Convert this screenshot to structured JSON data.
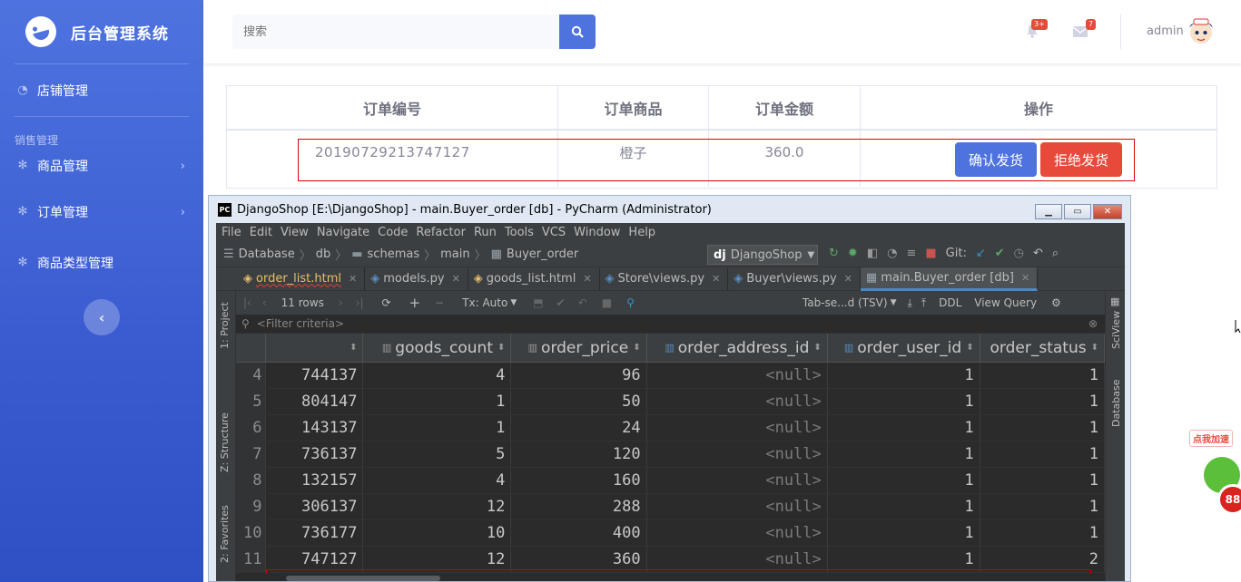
{
  "sidebar": {
    "brand": "后台管理系统",
    "items": [
      {
        "label": "店铺管理"
      },
      {
        "label": "商品管理"
      },
      {
        "label": "订单管理"
      },
      {
        "label": "商品类型管理"
      }
    ],
    "heading": "销售管理"
  },
  "topbar": {
    "search_placeholder": "搜索",
    "bell_badge": "3+",
    "mail_badge": "7",
    "user": "admin"
  },
  "order_table": {
    "headers": [
      "订单编号",
      "订单商品",
      "订单金额",
      "操作"
    ],
    "row": {
      "id": "20190729213747127",
      "goods": "橙子",
      "amount": "360.0"
    },
    "confirm_label": "确认发货",
    "reject_label": "拒绝发货"
  },
  "pycharm": {
    "title": "DjangoShop [E:\\DjangoShop] - main.Buyer_order [db] - PyCharm (Administrator)",
    "menu": [
      "File",
      "Edit",
      "View",
      "Navigate",
      "Code",
      "Refactor",
      "Run",
      "Tools",
      "VCS",
      "Window",
      "Help"
    ],
    "breadcrumbs": [
      "Database",
      "db",
      "schemas",
      "main",
      "Buyer_order"
    ],
    "run_config": "DjangoShop",
    "git_label": "Git:",
    "tabs": [
      {
        "label": "order_list.html",
        "type": "html"
      },
      {
        "label": "models.py",
        "type": "py"
      },
      {
        "label": "goods_list.html",
        "type": "html"
      },
      {
        "label": "Store\\views.py",
        "type": "py"
      },
      {
        "label": "Buyer\\views.py",
        "type": "py"
      },
      {
        "label": "main.Buyer_order [db]",
        "type": "db",
        "active": true
      }
    ],
    "rows_count": "11 rows",
    "tx_mode": "Tx: Auto",
    "export_format": "Tab-se...d (TSV)",
    "ddl_label": "DDL",
    "view_query_label": "View Query",
    "filter_placeholder": "<Filter criteria>",
    "left_strip": [
      "1: Project",
      "Z: Structure",
      "2: Favorites"
    ],
    "right_strip": [
      "SciView",
      "Database"
    ],
    "columns": [
      "goods_count",
      "order_price",
      "order_address_id",
      "order_user_id",
      "order_status"
    ],
    "rows": [
      {
        "n": "4",
        "c0": "744137",
        "goods_count": "4",
        "order_price": "96",
        "addr": "<null>",
        "user": "1",
        "status": "1"
      },
      {
        "n": "5",
        "c0": "804147",
        "goods_count": "1",
        "order_price": "50",
        "addr": "<null>",
        "user": "1",
        "status": "1"
      },
      {
        "n": "6",
        "c0": "143137",
        "goods_count": "1",
        "order_price": "24",
        "addr": "<null>",
        "user": "1",
        "status": "1"
      },
      {
        "n": "7",
        "c0": "736137",
        "goods_count": "5",
        "order_price": "120",
        "addr": "<null>",
        "user": "1",
        "status": "1"
      },
      {
        "n": "8",
        "c0": "132157",
        "goods_count": "4",
        "order_price": "160",
        "addr": "<null>",
        "user": "1",
        "status": "1"
      },
      {
        "n": "9",
        "c0": "306137",
        "goods_count": "12",
        "order_price": "288",
        "addr": "<null>",
        "user": "1",
        "status": "1"
      },
      {
        "n": "10",
        "c0": "736177",
        "goods_count": "10",
        "order_price": "400",
        "addr": "<null>",
        "user": "1",
        "status": "1"
      },
      {
        "n": "11",
        "c0": "747127",
        "goods_count": "12",
        "order_price": "360",
        "addr": "<null>",
        "user": "1",
        "status": "2"
      }
    ]
  },
  "float_widget": {
    "label": "点我加速",
    "count": "88"
  },
  "colors": {
    "primary": "#4e73df",
    "danger": "#e74a3b",
    "ide_bg": "#2b2b2b"
  }
}
